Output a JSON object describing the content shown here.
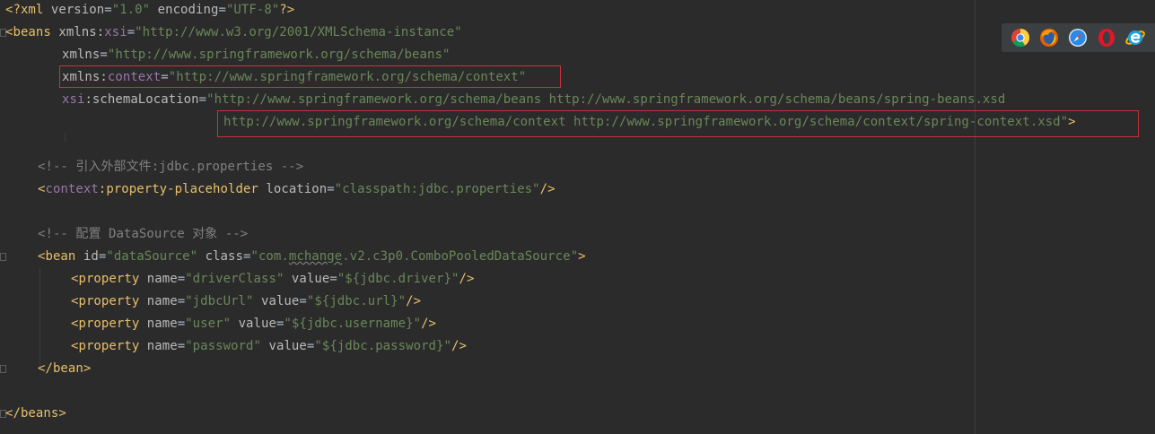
{
  "xml_decl": {
    "open": "<?xml ",
    "version_attr": "version",
    "version_val": "\"1.0\"",
    "encoding_attr": "encoding",
    "encoding_val": "\"UTF-8\"",
    "close": "?>"
  },
  "beans_open": {
    "tag": "<beans",
    "xmlns_xsi_prefix": "xmlns",
    "xmlns_xsi_local": "xsi",
    "xmlns_xsi_val": "\"http://www.w3.org/2001/XMLSchema-instance\"",
    "xmlns_attr": "xmlns",
    "xmlns_val": "\"http://www.springframework.org/schema/beans\"",
    "xmlns_ctx_prefix": "xmlns",
    "xmlns_ctx_local": "context",
    "xmlns_ctx_val": "\"http://www.springframework.org/schema/context\"",
    "schema_prefix": "xsi",
    "schema_local": "schemaLocation",
    "schema_val_1": "\"http://www.springframework.org/schema/beans http://www.springframework.org/schema/beans/spring-beans.xsd",
    "schema_val_2": "http://www.springframework.org/schema/context http://www.springframework.org/schema/context/spring-context.xsd\"",
    "schema_end": ">"
  },
  "comment_1": "<!-- 引入外部文件:jdbc.properties -->",
  "placeholder": {
    "open": "<",
    "prefix": "context",
    "local": "property-placeholder",
    "attr": "location",
    "val": "\"classpath:jdbc.properties\"",
    "close": "/>"
  },
  "comment_2": "<!-- 配置 DataSource 对象 -->",
  "bean": {
    "open": "<bean",
    "id_attr": "id",
    "id_val": "\"dataSource\"",
    "class_attr": "class",
    "class_val_a": "\"com.",
    "class_val_b": "mchange",
    "class_val_c": ".v2.c3p0.ComboPooledDataSource\"",
    "open_end": ">",
    "close": "</bean>"
  },
  "properties": [
    {
      "name": "\"driverClass\"",
      "value": "\"${jdbc.driver}\""
    },
    {
      "name": "\"jdbcUrl\"",
      "value": "\"${jdbc.url}\""
    },
    {
      "name": "\"user\"",
      "value": "\"${jdbc.username}\""
    },
    {
      "name": "\"password\"",
      "value": "\"${jdbc.password}\""
    }
  ],
  "prop_labels": {
    "open": "<property",
    "name_attr": "name",
    "value_attr": "value",
    "close": "/>"
  },
  "beans_close": "</beans>",
  "browsers": [
    "chrome-icon",
    "firefox-icon",
    "safari-icon",
    "opera-icon",
    "ie-icon"
  ],
  "colors": {
    "background": "#2b2b2b",
    "tag": "#e8bf6a",
    "attribute": "#bababa",
    "namespace": "#9876aa",
    "value": "#6a8759",
    "comment": "#808080",
    "highlight_border": "#c7323b"
  }
}
